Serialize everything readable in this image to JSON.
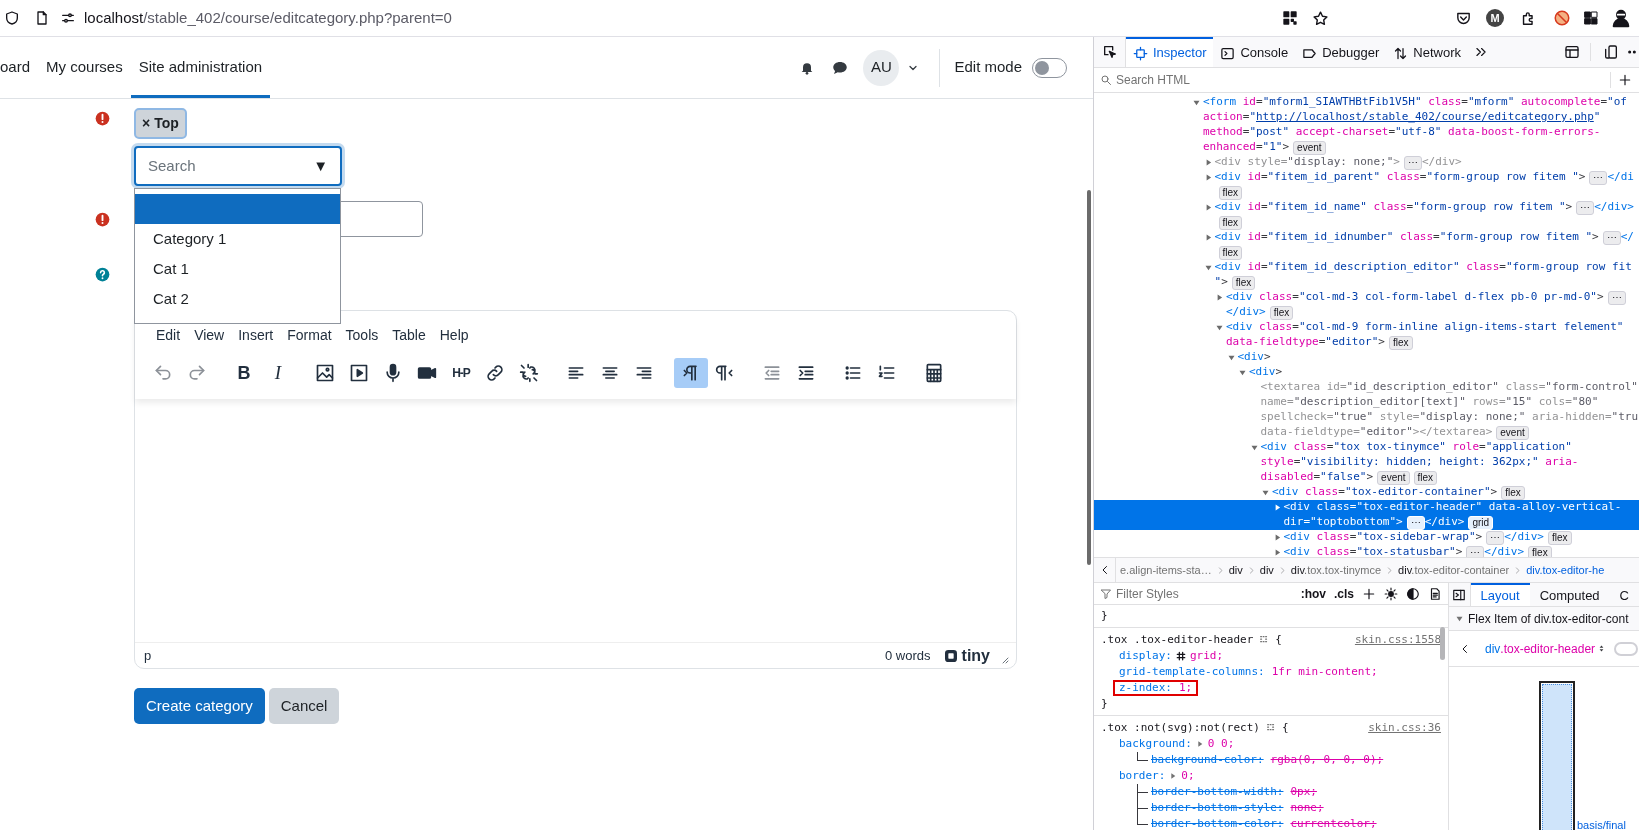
{
  "browser": {
    "url_host": "localhost",
    "url_path": "/stable_402/course/editcategory.php?parent=0",
    "profile_initial": "M"
  },
  "nav": {
    "items": [
      {
        "label": "oard",
        "selected": false
      },
      {
        "label": "My courses",
        "selected": false
      },
      {
        "label": "Site administration",
        "selected": true
      }
    ],
    "avatar": "AU",
    "edit_mode": {
      "label": "Edit mode",
      "on": false
    }
  },
  "form": {
    "parent": {
      "marker": {
        "kind": "error"
      },
      "chip": {
        "remove": "×",
        "label": "Top"
      },
      "search": {
        "placeholder": "Search",
        "caret": "▼"
      },
      "options": [
        {
          "selected": true
        },
        {
          "label": "Category 1",
          "selected": false
        },
        {
          "label": "Cat 1",
          "selected": false
        },
        {
          "label": "Cat 2",
          "selected": false
        }
      ]
    },
    "name": {
      "marker": {
        "kind": "error"
      }
    },
    "description": {
      "marker": {
        "kind": "help"
      }
    }
  },
  "editor": {
    "menu": [
      "Edit",
      "View",
      "Insert",
      "Format",
      "Tools",
      "Table",
      "Help"
    ],
    "toolbar": [
      [
        {
          "kind": "undo",
          "disabled": true,
          "active": false
        },
        {
          "kind": "redo",
          "disabled": true,
          "active": false
        }
      ],
      [
        {
          "kind": "bold",
          "glyph": "B",
          "disabled": false,
          "active": false
        },
        {
          "kind": "italic",
          "glyph": "I",
          "disabled": false,
          "active": false
        }
      ],
      [
        {
          "kind": "image",
          "disabled": false,
          "active": false
        },
        {
          "kind": "media",
          "disabled": false,
          "active": false
        },
        {
          "kind": "mic",
          "disabled": false,
          "active": false
        },
        {
          "kind": "video",
          "disabled": false,
          "active": false
        },
        {
          "kind": "hp",
          "glyph": "H-P",
          "disabled": false,
          "active": false
        },
        {
          "kind": "link",
          "disabled": false,
          "active": false
        },
        {
          "kind": "unlink",
          "disabled": false,
          "active": false
        }
      ],
      [
        {
          "kind": "align-left",
          "disabled": false,
          "active": false
        },
        {
          "kind": "align-center",
          "disabled": false,
          "active": false
        },
        {
          "kind": "align-right",
          "disabled": false,
          "active": false
        }
      ],
      [
        {
          "kind": "ltr",
          "disabled": false,
          "active": true
        },
        {
          "kind": "rtl",
          "disabled": false,
          "active": false
        }
      ],
      [
        {
          "kind": "outdent",
          "disabled": true,
          "active": false
        },
        {
          "kind": "indent",
          "disabled": false,
          "active": false
        }
      ],
      [
        {
          "kind": "bullets",
          "disabled": false,
          "active": false
        },
        {
          "kind": "numbers",
          "disabled": false,
          "active": false
        }
      ],
      [
        {
          "kind": "calculator",
          "disabled": false,
          "active": false
        }
      ]
    ],
    "status": {
      "path": "p",
      "words": "0 words",
      "brand": "tiny"
    }
  },
  "buttons": [
    {
      "label": "Create category",
      "kind": "primary"
    },
    {
      "label": "Cancel",
      "kind": "secondary"
    }
  ],
  "devtools": {
    "tabs": [
      {
        "label": "Inspector",
        "kind": "inspector",
        "selected": true
      },
      {
        "label": "Console",
        "kind": "console",
        "selected": false
      },
      {
        "label": "Debugger",
        "kind": "debugger",
        "selected": false
      },
      {
        "label": "Network",
        "kind": "network",
        "selected": false
      }
    ],
    "search": {
      "placeholder": "Search HTML"
    },
    "markup": [
      {
        "kind": "element",
        "expanded": true,
        "selected": false,
        "lines": [
          [
            {
              "kind": "tag",
              "text": "<form"
            },
            {
              "kind": "attr",
              "text": " id"
            },
            {
              "kind": "p",
              "text": "="
            },
            {
              "kind": "val",
              "text": "\"mform1_SIAWTHBtFib1V5H\""
            },
            {
              "kind": "attr",
              "text": " class"
            },
            {
              "kind": "p",
              "text": "="
            },
            {
              "kind": "val",
              "text": "\"mform\""
            },
            {
              "kind": "attr",
              "text": " autocomplete"
            },
            {
              "kind": "p",
              "text": "="
            },
            {
              "kind": "val",
              "text": "\"of"
            }
          ],
          [
            {
              "kind": "attr",
              "text": "action"
            },
            {
              "kind": "p",
              "text": "="
            },
            {
              "kind": "val",
              "text": "\""
            },
            {
              "kind": "link",
              "text": "http://localhost/stable_402/course/editcategory.php"
            },
            {
              "kind": "val",
              "text": "\""
            }
          ],
          [
            {
              "kind": "attr",
              "text": "method"
            },
            {
              "kind": "p",
              "text": "="
            },
            {
              "kind": "val",
              "text": "\"post\""
            },
            {
              "kind": "attr",
              "text": " accept-charset"
            },
            {
              "kind": "p",
              "text": "="
            },
            {
              "kind": "val",
              "text": "\"utf-8\""
            },
            {
              "kind": "attr",
              "text": " data-boost-form-errors-"
            }
          ],
          [
            {
              "kind": "attr",
              "text": "enhanced"
            },
            {
              "kind": "p",
              "text": "="
            },
            {
              "kind": "val",
              "text": "\"1\""
            },
            {
              "kind": "p",
              "text": ">"
            },
            {
              "kind": "badge",
              "text": "event"
            }
          ]
        ],
        "children": [
          {
            "kind": "element",
            "expanded": false,
            "selected": false,
            "lines": [
              [
                {
                  "kind": "dtag",
                  "text": "<div style="
                },
                {
                  "kind": "dval",
                  "text": "\"display: none;\""
                },
                {
                  "kind": "dtag",
                  "text": ">"
                },
                {
                  "kind": "more",
                  "text": "⋯"
                },
                {
                  "kind": "dtag",
                  "text": "</div>"
                }
              ]
            ]
          },
          {
            "kind": "element",
            "expanded": false,
            "selected": false,
            "lines": [
              [
                {
                  "kind": "tag",
                  "text": "<div"
                },
                {
                  "kind": "attr",
                  "text": " id"
                },
                {
                  "kind": "p",
                  "text": "="
                },
                {
                  "kind": "val",
                  "text": "\"fitem_id_parent\""
                },
                {
                  "kind": "attr",
                  "text": " class"
                },
                {
                  "kind": "p",
                  "text": "="
                },
                {
                  "kind": "val",
                  "text": "\"form-group row fitem \""
                },
                {
                  "kind": "p",
                  "text": ">"
                },
                {
                  "kind": "more",
                  "text": "⋯"
                },
                {
                  "kind": "tag",
                  "text": "</di"
                }
              ],
              [
                {
                  "kind": "badge",
                  "text": "flex"
                }
              ]
            ]
          },
          {
            "kind": "element",
            "expanded": false,
            "selected": false,
            "lines": [
              [
                {
                  "kind": "tag",
                  "text": "<div"
                },
                {
                  "kind": "attr",
                  "text": " id"
                },
                {
                  "kind": "p",
                  "text": "="
                },
                {
                  "kind": "val",
                  "text": "\"fitem_id_name\""
                },
                {
                  "kind": "attr",
                  "text": " class"
                },
                {
                  "kind": "p",
                  "text": "="
                },
                {
                  "kind": "val",
                  "text": "\"form-group row fitem \""
                },
                {
                  "kind": "p",
                  "text": ">"
                },
                {
                  "kind": "more",
                  "text": "⋯"
                },
                {
                  "kind": "tag",
                  "text": "</div>"
                }
              ],
              [
                {
                  "kind": "badge",
                  "text": "flex"
                }
              ]
            ]
          },
          {
            "kind": "element",
            "expanded": false,
            "selected": false,
            "lines": [
              [
                {
                  "kind": "tag",
                  "text": "<div"
                },
                {
                  "kind": "attr",
                  "text": " id"
                },
                {
                  "kind": "p",
                  "text": "="
                },
                {
                  "kind": "val",
                  "text": "\"fitem_id_idnumber\""
                },
                {
                  "kind": "attr",
                  "text": " class"
                },
                {
                  "kind": "p",
                  "text": "="
                },
                {
                  "kind": "val",
                  "text": "\"form-group row fitem \""
                },
                {
                  "kind": "p",
                  "text": ">"
                },
                {
                  "kind": "more",
                  "text": "⋯"
                },
                {
                  "kind": "tag",
                  "text": "</"
                }
              ],
              [
                {
                  "kind": "badge",
                  "text": "flex"
                }
              ]
            ]
          },
          {
            "kind": "element",
            "expanded": true,
            "selected": false,
            "lines": [
              [
                {
                  "kind": "tag",
                  "text": "<div"
                },
                {
                  "kind": "attr",
                  "text": " id"
                },
                {
                  "kind": "p",
                  "text": "="
                },
                {
                  "kind": "val",
                  "text": "\"fitem_id_description_editor\""
                },
                {
                  "kind": "attr",
                  "text": " class"
                },
                {
                  "kind": "p",
                  "text": "="
                },
                {
                  "kind": "val",
                  "text": "\"form-group row fit"
                }
              ],
              [
                {
                  "kind": "val",
                  "text": "\""
                },
                {
                  "kind": "p",
                  "text": ">"
                },
                {
                  "kind": "badge",
                  "text": "flex"
                }
              ]
            ],
            "children": [
              {
                "kind": "element",
                "expanded": false,
                "selected": false,
                "lines": [
                  [
                    {
                      "kind": "tag",
                      "text": "<div"
                    },
                    {
                      "kind": "attr",
                      "text": " class"
                    },
                    {
                      "kind": "p",
                      "text": "="
                    },
                    {
                      "kind": "val",
                      "text": "\"col-md-3 col-form-label d-flex pb-0 pr-md-0\""
                    },
                    {
                      "kind": "p",
                      "text": ">"
                    },
                    {
                      "kind": "more",
                      "text": "⋯"
                    }
                  ],
                  [
                    {
                      "kind": "tag",
                      "text": "</div>"
                    },
                    {
                      "kind": "badge",
                      "text": "flex"
                    }
                  ]
                ]
              },
              {
                "kind": "element",
                "expanded": true,
                "selected": false,
                "lines": [
                  [
                    {
                      "kind": "tag",
                      "text": "<div"
                    },
                    {
                      "kind": "attr",
                      "text": " class"
                    },
                    {
                      "kind": "p",
                      "text": "="
                    },
                    {
                      "kind": "val",
                      "text": "\"col-md-9 form-inline align-items-start felement\""
                    }
                  ],
                  [
                    {
                      "kind": "attr",
                      "text": "data-fieldtype"
                    },
                    {
                      "kind": "p",
                      "text": "="
                    },
                    {
                      "kind": "val",
                      "text": "\"editor\""
                    },
                    {
                      "kind": "p",
                      "text": ">"
                    },
                    {
                      "kind": "badge",
                      "text": "flex"
                    }
                  ]
                ],
                "children": [
                  {
                    "kind": "element",
                    "expanded": true,
                    "selected": false,
                    "lines": [
                      [
                        {
                          "kind": "tag",
                          "text": "<div"
                        },
                        {
                          "kind": "p",
                          "text": ">"
                        }
                      ]
                    ],
                    "children": [
                      {
                        "kind": "element",
                        "expanded": true,
                        "selected": false,
                        "lines": [
                          [
                            {
                              "kind": "tag",
                              "text": "<div"
                            },
                            {
                              "kind": "p",
                              "text": ">"
                            }
                          ]
                        ],
                        "children": [
                          {
                            "kind": "leaf",
                            "selected": false,
                            "lines": [
                              [
                                {
                                  "kind": "dtag",
                                  "text": "<textarea id="
                                },
                                {
                                  "kind": "dval",
                                  "text": "\"id_description_editor\""
                                },
                                {
                                  "kind": "dtag",
                                  "text": " class="
                                },
                                {
                                  "kind": "dval",
                                  "text": "\"form-control\""
                                }
                              ],
                              [
                                {
                                  "kind": "dtag",
                                  "text": "name="
                                },
                                {
                                  "kind": "dval",
                                  "text": "\"description_editor[text]\""
                                },
                                {
                                  "kind": "dtag",
                                  "text": " rows="
                                },
                                {
                                  "kind": "dval",
                                  "text": "\"15\""
                                },
                                {
                                  "kind": "dtag",
                                  "text": " cols="
                                },
                                {
                                  "kind": "dval",
                                  "text": "\"80\""
                                }
                              ],
                              [
                                {
                                  "kind": "dtag",
                                  "text": "spellcheck="
                                },
                                {
                                  "kind": "dval",
                                  "text": "\"true\""
                                },
                                {
                                  "kind": "dtag",
                                  "text": " style="
                                },
                                {
                                  "kind": "dval",
                                  "text": "\"display: none;\""
                                },
                                {
                                  "kind": "dtag",
                                  "text": " aria-hidden="
                                },
                                {
                                  "kind": "dval",
                                  "text": "\"tru"
                                }
                              ],
                              [
                                {
                                  "kind": "dtag",
                                  "text": "data-fieldtype="
                                },
                                {
                                  "kind": "dval",
                                  "text": "\"editor\""
                                },
                                {
                                  "kind": "dtag",
                                  "text": "></textarea>"
                                },
                                {
                                  "kind": "badge",
                                  "text": "event"
                                }
                              ]
                            ]
                          },
                          {
                            "kind": "element",
                            "expanded": true,
                            "selected": false,
                            "lines": [
                              [
                                {
                                  "kind": "tag",
                                  "text": "<div"
                                },
                                {
                                  "kind": "attr",
                                  "text": " class"
                                },
                                {
                                  "kind": "p",
                                  "text": "="
                                },
                                {
                                  "kind": "val",
                                  "text": "\"tox tox-tinymce\""
                                },
                                {
                                  "kind": "attr",
                                  "text": " role"
                                },
                                {
                                  "kind": "p",
                                  "text": "="
                                },
                                {
                                  "kind": "val",
                                  "text": "\"application\""
                                }
                              ],
                              [
                                {
                                  "kind": "attr",
                                  "text": "style"
                                },
                                {
                                  "kind": "p",
                                  "text": "="
                                },
                                {
                                  "kind": "val",
                                  "text": "\"visibility: hidden; height: 362px;\""
                                },
                                {
                                  "kind": "attr",
                                  "text": " aria-"
                                }
                              ],
                              [
                                {
                                  "kind": "attr",
                                  "text": "disabled"
                                },
                                {
                                  "kind": "p",
                                  "text": "="
                                },
                                {
                                  "kind": "val",
                                  "text": "\"false\""
                                },
                                {
                                  "kind": "p",
                                  "text": ">"
                                },
                                {
                                  "kind": "badge",
                                  "text": "event"
                                },
                                {
                                  "kind": "badge",
                                  "text": "flex"
                                }
                              ]
                            ],
                            "children": [
                              {
                                "kind": "element",
                                "expanded": true,
                                "selected": false,
                                "lines": [
                                  [
                                    {
                                      "kind": "tag",
                                      "text": "<div"
                                    },
                                    {
                                      "kind": "attr",
                                      "text": " class"
                                    },
                                    {
                                      "kind": "p",
                                      "text": "="
                                    },
                                    {
                                      "kind": "val",
                                      "text": "\"tox-editor-container\""
                                    },
                                    {
                                      "kind": "p",
                                      "text": ">"
                                    },
                                    {
                                      "kind": "badge",
                                      "text": "flex"
                                    }
                                  ]
                                ],
                                "children": [
                                  {
                                    "kind": "element",
                                    "expanded": false,
                                    "selected": true,
                                    "lines": [
                                      [
                                        {
                                          "kind": "tag",
                                          "text": "<div"
                                        },
                                        {
                                          "kind": "attr",
                                          "text": " class"
                                        },
                                        {
                                          "kind": "p",
                                          "text": "="
                                        },
                                        {
                                          "kind": "val",
                                          "text": "\"tox-editor-header\""
                                        },
                                        {
                                          "kind": "attr",
                                          "text": " data-alloy-vertical-"
                                        }
                                      ],
                                      [
                                        {
                                          "kind": "attr",
                                          "text": "dir"
                                        },
                                        {
                                          "kind": "p",
                                          "text": "="
                                        },
                                        {
                                          "kind": "val",
                                          "text": "\"toptobottom\""
                                        },
                                        {
                                          "kind": "p",
                                          "text": ">"
                                        },
                                        {
                                          "kind": "more",
                                          "text": "⋯"
                                        },
                                        {
                                          "kind": "tag",
                                          "text": "</div>"
                                        },
                                        {
                                          "kind": "badge",
                                          "text": "grid"
                                        }
                                      ]
                                    ]
                                  },
                                  {
                                    "kind": "element",
                                    "expanded": false,
                                    "selected": false,
                                    "lines": [
                                      [
                                        {
                                          "kind": "tag",
                                          "text": "<div"
                                        },
                                        {
                                          "kind": "attr",
                                          "text": " class"
                                        },
                                        {
                                          "kind": "p",
                                          "text": "="
                                        },
                                        {
                                          "kind": "val",
                                          "text": "\"tox-sidebar-wrap\""
                                        },
                                        {
                                          "kind": "p",
                                          "text": ">"
                                        },
                                        {
                                          "kind": "more",
                                          "text": "⋯"
                                        },
                                        {
                                          "kind": "tag",
                                          "text": "</div>"
                                        },
                                        {
                                          "kind": "badge",
                                          "text": "flex"
                                        }
                                      ]
                                    ]
                                  },
                                  {
                                    "kind": "element",
                                    "expanded": false,
                                    "selected": false,
                                    "lines": [
                                      [
                                        {
                                          "kind": "tag",
                                          "text": "<div"
                                        },
                                        {
                                          "kind": "attr",
                                          "text": " class"
                                        },
                                        {
                                          "kind": "p",
                                          "text": "="
                                        },
                                        {
                                          "kind": "val",
                                          "text": "\"tox-statusbar\""
                                        },
                                        {
                                          "kind": "p",
                                          "text": ">"
                                        },
                                        {
                                          "kind": "more",
                                          "text": "⋯"
                                        },
                                        {
                                          "kind": "tag",
                                          "text": "</div>"
                                        },
                                        {
                                          "kind": "badge",
                                          "text": "flex"
                                        }
                                      ]
                                    ]
                                  }
                                ]
                              }
                            ]
                          }
                        ]
                      }
                    ]
                  }
                ]
              }
            ]
          }
        ]
      }
    ],
    "breadcrumbs": [
      {
        "cls": "e.align-items-sta…",
        "selected": false
      },
      {
        "tag": "div",
        "selected": false
      },
      {
        "tag": "div",
        "selected": false
      },
      {
        "tag": "div",
        "cls": ".tox.tox-tinymce",
        "selected": false
      },
      {
        "tag": "div",
        "cls": ".tox-editor-container",
        "selected": false
      },
      {
        "tag": "div",
        "cls": ".tox-editor-he",
        "selected": true
      }
    ],
    "rules": {
      "filter": {
        "placeholder": "Filter Styles"
      },
      "toggles": [
        ":hov",
        ".cls"
      ],
      "list": [
        {
          "kind": "tail",
          "close": "}"
        },
        {
          "kind": "rule",
          "selector": ".tox .tox-editor-header",
          "open": "{",
          "close": "}",
          "source": "skin.css:1558",
          "decls": [
            {
              "kind": "grid",
              "prop": "display:",
              "value": "grid;",
              "highlighted": false,
              "overridden": false
            },
            {
              "kind": "plain",
              "prop": "grid-template-columns:",
              "value": "1fr min-content;",
              "highlighted": false,
              "overridden": false
            },
            {
              "kind": "plain",
              "prop": "z-index:",
              "value": "1;",
              "highlighted": true,
              "overridden": false
            }
          ]
        },
        {
          "kind": "rule",
          "selector": ".tox :not(svg):not(rect)",
          "open": "{",
          "source": "skin.css:36",
          "decls": [
            {
              "kind": "shorthand",
              "prop": "background:",
              "value": "0 0;",
              "highlighted": false,
              "overridden": false,
              "children": [
                {
                  "prop": "background-color:",
                  "value": "rgba(0, 0, 0, 0);",
                  "highlighted": false,
                  "overridden": true
                }
              ]
            },
            {
              "kind": "shorthand",
              "prop": "border:",
              "value": "0;",
              "highlighted": false,
              "overridden": false,
              "children": [
                {
                  "prop": "border-bottom-width:",
                  "value": "0px;",
                  "highlighted": false,
                  "overridden": true
                },
                {
                  "prop": "border-bottom-style:",
                  "value": "none;",
                  "highlighted": false,
                  "overridden": true
                },
                {
                  "prop": "border-bottom-color:",
                  "value": "currentcolor;",
                  "highlighted": false,
                  "overridden": true
                }
              ]
            }
          ]
        }
      ]
    },
    "layout": {
      "tabs": [
        {
          "label": "Layout",
          "selected": true
        },
        {
          "label": "Computed",
          "selected": false
        },
        {
          "label": "C",
          "selected": false
        }
      ],
      "section": {
        "title": "Flex Item of div.tox-editor-cont",
        "expanded": true
      },
      "element": {
        "tag": "div",
        "cls": ".tox-editor-header"
      },
      "toggle": {
        "on": false
      },
      "diagram_label": "basis/final"
    }
  }
}
